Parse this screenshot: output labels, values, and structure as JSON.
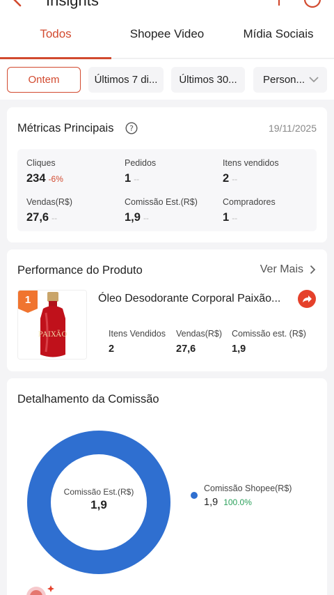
{
  "header": {
    "title": "Insights"
  },
  "tabs": [
    {
      "label": "Todos",
      "active": true
    },
    {
      "label": "Shopee Video",
      "active": false
    },
    {
      "label": "Mídia Sociais",
      "active": false
    }
  ],
  "filters": [
    {
      "label": "Ontem",
      "active": true
    },
    {
      "label": "Últimos 7 di...",
      "active": false
    },
    {
      "label": "Últimos 30...",
      "active": false
    },
    {
      "label": "Person...",
      "active": false
    }
  ],
  "metrics": {
    "title": "Métricas Principais",
    "date": "19/11/2025",
    "items": [
      {
        "label": "Cliques",
        "value": "234",
        "change": "-6%"
      },
      {
        "label": "Pedidos",
        "value": "1",
        "change": "--"
      },
      {
        "label": "Itens vendidos",
        "value": "2",
        "change": "--"
      },
      {
        "label": "Vendas(R$)",
        "value": "27,6",
        "change": "--"
      },
      {
        "label": "Comissão Est.(R$)",
        "value": "1,9",
        "change": "--"
      },
      {
        "label": "Compradores",
        "value": "1",
        "change": "--"
      }
    ]
  },
  "performance": {
    "title": "Performance do Produto",
    "see_more": "Ver Mais",
    "product": {
      "rank": "1",
      "image_label": "PAIXÃO",
      "name": "Óleo Desodorante Corporal Paixão...",
      "stats": [
        {
          "label": "Itens Vendidos",
          "value": "2"
        },
        {
          "label": "Vendas(R$)",
          "value": "27,6"
        },
        {
          "label": "Comissão est. (R$)",
          "value": "1,9"
        }
      ]
    }
  },
  "commission": {
    "title": "Detalhamento da Comissão",
    "donut_center_label": "Comissão Est.(R$)",
    "donut_center_value": "1,9",
    "legend": [
      {
        "label": "Comissão Shopee(R$)",
        "value": "1,9",
        "percent": "100.0%",
        "color": "#2f6fd0"
      }
    ]
  },
  "colors": {
    "accent": "#d24a2f",
    "donut": "#2f6fd0",
    "positive": "#2aa05a"
  }
}
